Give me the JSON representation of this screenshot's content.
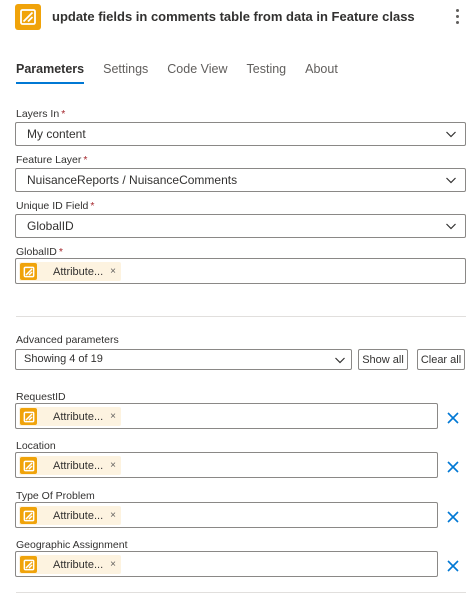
{
  "header": {
    "title": "update fields in comments table from data in Feature class",
    "app_icon": "arcgis-connector-icon",
    "more_icon": "more-options-icon"
  },
  "tabs": [
    {
      "label": "Parameters",
      "active": true
    },
    {
      "label": "Settings",
      "active": false
    },
    {
      "label": "Code View",
      "active": false
    },
    {
      "label": "Testing",
      "active": false
    },
    {
      "label": "About",
      "active": false
    }
  ],
  "fields": {
    "layers_in": {
      "label": "Layers In",
      "required_mark": "*",
      "value": "My content"
    },
    "feature_layer": {
      "label": "Feature Layer",
      "required_mark": "*",
      "value": "NuisanceReports / NuisanceComments"
    },
    "unique_id_field": {
      "label": "Unique ID Field",
      "required_mark": "*",
      "value": "GlobalID"
    },
    "global_id": {
      "label": "GlobalID",
      "required_mark": "*",
      "token": "Attribute...",
      "token_close": "×"
    }
  },
  "advanced": {
    "label": "Advanced parameters",
    "select_value": "Showing 4 of 19",
    "show_all": "Show all",
    "clear_all": "Clear all"
  },
  "advanced_fields": [
    {
      "label": "RequestID",
      "token": "Attribute...",
      "token_close": "×"
    },
    {
      "label": "Location",
      "token": "Attribute...",
      "token_close": "×"
    },
    {
      "label": "Type Of Problem",
      "token": "Attribute...",
      "token_close": "×"
    },
    {
      "label": "Geographic Assignment",
      "token": "Attribute...",
      "token_close": "×"
    }
  ],
  "colors": {
    "accent": "#0078d4",
    "connector_icon": "#f0a30a",
    "token_bg": "#fdf3e0",
    "required": "#a4262c"
  }
}
